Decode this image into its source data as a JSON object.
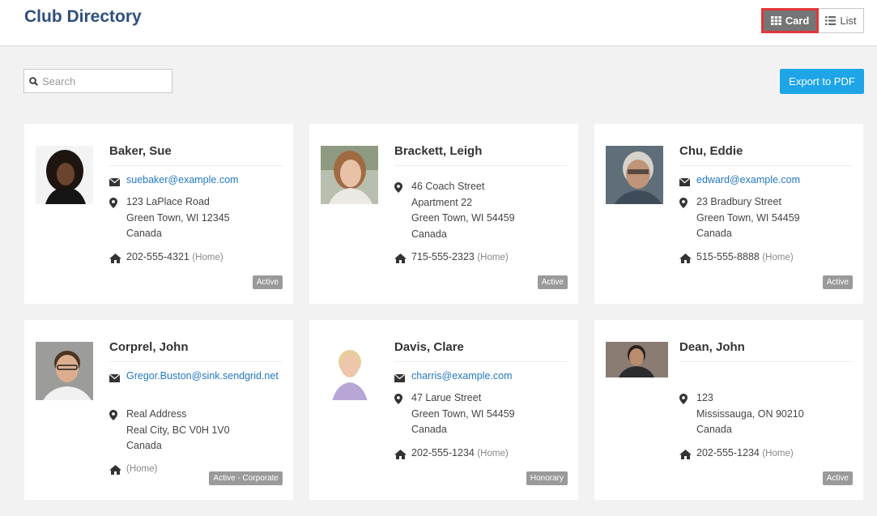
{
  "header": {
    "title": "Club Directory"
  },
  "view_toggle": {
    "card_label": "Card",
    "list_label": "List",
    "active": "card"
  },
  "search": {
    "placeholder": "Search"
  },
  "toolbar": {
    "export_label": "Export to PDF"
  },
  "colors": {
    "title": "#2d4f7c",
    "link": "#2478c2",
    "export": "#1ea5e8",
    "badge": "#9a9a9a",
    "highlight": "#e23636"
  },
  "members": [
    {
      "name": "Baker, Sue",
      "email": "suebaker@example.com",
      "address": [
        "123 LaPlace Road",
        "Green Town, WI 12345",
        "Canada"
      ],
      "phone": "202-555-4321",
      "phone_type": "(Home)",
      "status": "Active"
    },
    {
      "name": "Brackett, Leigh",
      "email": "",
      "address": [
        "46 Coach Street",
        "Apartment 22",
        "Green Town, WI 54459",
        "Canada"
      ],
      "phone": "715-555-2323",
      "phone_type": "(Home)",
      "status": "Active"
    },
    {
      "name": "Chu, Eddie",
      "email": "edward@example.com",
      "address": [
        "23 Bradbury Street",
        "Green Town, WI 54459",
        "Canada"
      ],
      "phone": "515-555-8888",
      "phone_type": "(Home)",
      "status": "Active"
    },
    {
      "name": "Corprel, John",
      "email": "Gregor.Buston@sink.sendgrid.net",
      "address": [
        "Real Address",
        "Real City, BC V0H 1V0",
        "Canada"
      ],
      "phone": "",
      "phone_type": "(Home)",
      "status": "Active - Corporate"
    },
    {
      "name": "Davis, Clare",
      "email": "charris@example.com",
      "address": [
        "47 Larue Street",
        "Green Town, WI 54459",
        "Canada"
      ],
      "phone": "202-555-1234",
      "phone_type": "(Home)",
      "status": "Honorary"
    },
    {
      "name": "Dean, John",
      "email": "",
      "address": [
        "123",
        "Mississauga, ON 90210",
        "Canada"
      ],
      "phone": "202-555-1234",
      "phone_type": "(Home)",
      "status": "Active"
    }
  ]
}
